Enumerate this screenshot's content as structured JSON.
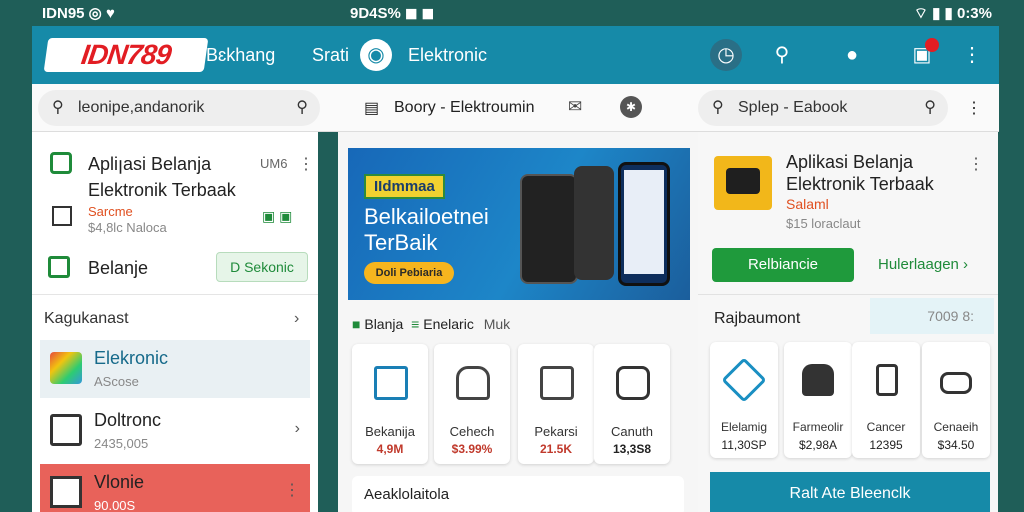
{
  "statusbar": {
    "left": "IDN95 ◎ ♥",
    "center": "9D4S% ◼ ◼",
    "right": "⌔ ▮ ▮ 0:3%"
  },
  "appbar": {
    "logo": "IDN789",
    "nav": [
      "Bɛkhang",
      "Srati",
      "Elektronic"
    ]
  },
  "search_left": {
    "value": "leonipe,andanorik"
  },
  "center_bar": {
    "label": "Boory - Elektroumin"
  },
  "search_right": {
    "value": "Splep - Eabook"
  },
  "left": {
    "app": {
      "title_line1": "Apliꞁasi Belanja",
      "title_line2": "Elektronik Terbaak",
      "corner": "UM6",
      "promo": "Sarcme",
      "price": "$4,8lc Naloca"
    },
    "belanja": {
      "label": "Belanje",
      "button": "D Sekonic"
    },
    "section": "Kagukanast",
    "categories": [
      {
        "name": "Elekronic",
        "sub": "AScose"
      },
      {
        "name": "Doltronc",
        "sub": "2435,005"
      },
      {
        "name": "Vlonie",
        "sub": "90.00S"
      }
    ]
  },
  "banner": {
    "badge": "IIdmmaa",
    "headline_1": "Belkailoetnei",
    "headline_2": "TerBaik",
    "cta": "Doli Pebiaria"
  },
  "mid": {
    "tags": [
      "Blanja",
      "Enelaric",
      "Muk"
    ],
    "products": [
      {
        "name": "Bekanija",
        "price": "4,9M"
      },
      {
        "name": "Cehech",
        "price": "$3.99%"
      },
      {
        "name": "Pekarsi",
        "price": "21.5K"
      },
      {
        "name": "Canuth",
        "price": "13,3S8"
      }
    ],
    "footer": "Aeaklolaitola"
  },
  "right": {
    "app": {
      "title_line1": "Aplikasi Belanja",
      "title_line2": "Elektronik Terbaak",
      "promo": "Salaml",
      "price": "$15 loraclaut"
    },
    "primary_button": "Relbiancie",
    "link": "Hulerlaagen",
    "section": "Rajbaumont",
    "badge": "7009 8:",
    "products": [
      {
        "name": "Elelamig",
        "price": "11,30SP"
      },
      {
        "name": "Farmeolir",
        "price": "$2,98A"
      },
      {
        "name": "Cancer",
        "price": "12395"
      },
      {
        "name": "Cenaeih",
        "price": "$34.50"
      }
    ],
    "footer_button": "Ralt Ate Bleenclk"
  },
  "colors": {
    "teal": "#168aa8",
    "green": "#1f8b3a",
    "red": "#e21d23",
    "banner": "#1d86c8"
  }
}
